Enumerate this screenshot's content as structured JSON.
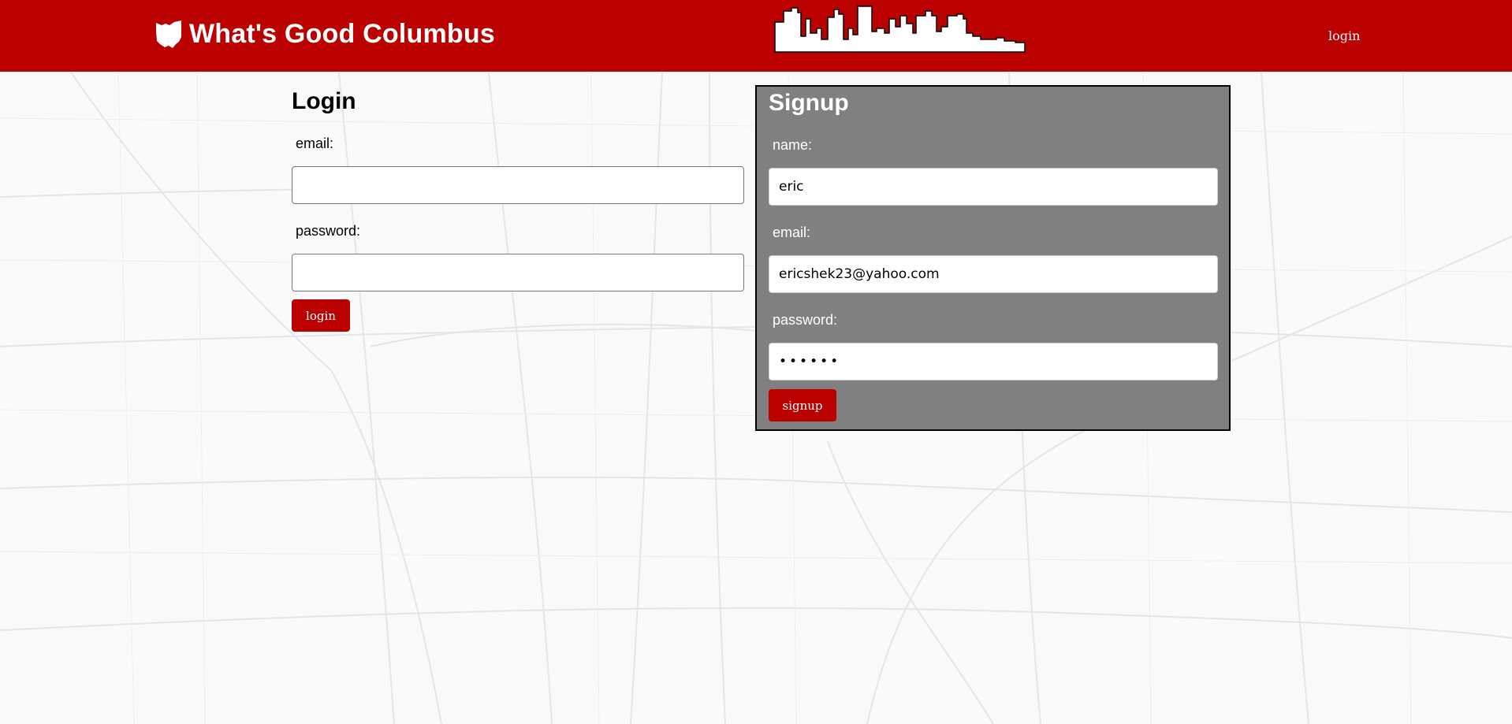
{
  "header": {
    "title": "What's Good Columbus",
    "login_link": "login",
    "brand_color": "#bb0000"
  },
  "login": {
    "heading": "Login",
    "email_label": "email:",
    "email_value": "",
    "password_label": "password:",
    "password_value": "",
    "button_label": "login"
  },
  "signup": {
    "heading": "Signup",
    "name_label": "name:",
    "name_value": "eric",
    "email_label": "email:",
    "email_value": "ericshek23@yahoo.com",
    "password_label": "password:",
    "password_value": "••••••",
    "button_label": "signup",
    "panel_color": "#808080"
  },
  "icons": {
    "brand": "ohio-state-icon",
    "skyline": "city-skyline"
  }
}
